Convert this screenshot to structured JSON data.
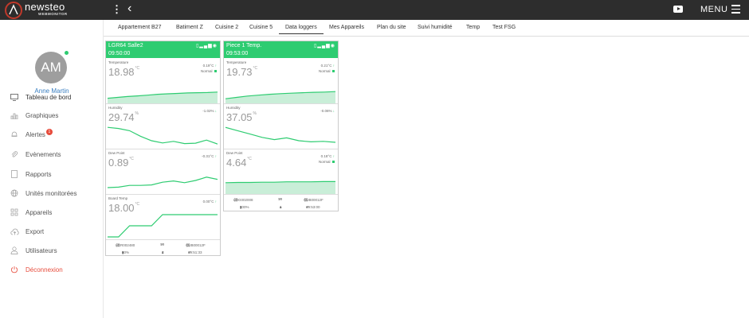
{
  "header": {
    "brand": "newsteo",
    "brand_sub": "WEBMONITOR",
    "menu_label": "MENU",
    "icons": [
      "logo-icon",
      "vertical-dots-icon",
      "back-chevron-icon",
      "video-icon",
      "hamburger-icon"
    ]
  },
  "user": {
    "initials": "AM",
    "name": "Anne Martin",
    "status_color": "#2ecc71"
  },
  "sidebar": {
    "items": [
      {
        "label": "Tableau de bord",
        "icon": "monitor-icon"
      },
      {
        "label": "Graphiques",
        "icon": "bar-chart-icon"
      },
      {
        "label": "Alertes",
        "icon": "bell-icon",
        "badge": "1"
      },
      {
        "label": "Evènements",
        "icon": "paperclip-icon"
      },
      {
        "label": "Rapports",
        "icon": "document-icon"
      },
      {
        "label": "Unités monitorées",
        "icon": "globe-icon"
      },
      {
        "label": "Appareils",
        "icon": "grid-icon"
      },
      {
        "label": "Export",
        "icon": "cloud-upload-icon"
      },
      {
        "label": "Utilisateurs",
        "icon": "user-icon"
      },
      {
        "label": "Déconnexion",
        "icon": "power-icon"
      }
    ]
  },
  "tabs": [
    "Appartement B27",
    "Batiment Z",
    "Cuisine 2",
    "Cuisine 5",
    "Data loggers",
    "Mes Appareils",
    "Plan du site",
    "Suivi humidité",
    "Temp",
    "Test FSG"
  ],
  "active_tab": "Data loggers",
  "colors": {
    "accent": "#2ecc71",
    "badge": "#e74c3c",
    "link": "#3a7fc1",
    "topbar": "#2d2d2d"
  },
  "loggers": [
    {
      "name": "LGR64 Salle2",
      "time": "09:50:00",
      "header_icons": [
        "sim-icon",
        "signal-icon",
        "wifi-icon"
      ],
      "sensors": [
        {
          "label": "Temperature",
          "value": "18.98",
          "unit": "°C",
          "delta": "0.19°C",
          "status": "Normal",
          "trend": "up",
          "area": true,
          "series": [
            12,
            16,
            20,
            23,
            26,
            30,
            32,
            34,
            36,
            37,
            38,
            40
          ]
        },
        {
          "label": "Humidity",
          "value": "29.74",
          "unit": "%",
          "delta": "-1.02%",
          "status": "",
          "trend": "down",
          "area": false,
          "series": [
            85,
            80,
            70,
            45,
            25,
            15,
            22,
            12,
            14,
            28,
            10
          ]
        },
        {
          "label": "Dew Point",
          "value": "0.89",
          "unit": "°C",
          "delta": "-0.31°C",
          "status": "",
          "trend": "up",
          "area": false,
          "series": [
            18,
            20,
            28,
            28,
            30,
            42,
            48,
            40,
            50,
            65,
            55
          ]
        },
        {
          "label": "Board Temp",
          "value": "18.00",
          "unit": "°C",
          "delta": "0.00°C",
          "status": "",
          "trend": "up",
          "area": false,
          "series": [
            0,
            0,
            50,
            50,
            50,
            100,
            100,
            100,
            100,
            100,
            100
          ]
        }
      ],
      "footer": {
        "id_left": "LGR002480",
        "range": "10",
        "range_unit": "min",
        "id_right": "CUB00012F",
        "battery": "60%",
        "signal": "7",
        "last": "09:51:33"
      }
    },
    {
      "name": "Piece 1 Temp.",
      "time": "09:53:00",
      "header_icons": [
        "sim-icon",
        "signal-icon",
        "wifi-icon"
      ],
      "sensors": [
        {
          "label": "Temperature",
          "value": "19.73",
          "unit": "°C",
          "delta": "0.21°C",
          "status": "Normal",
          "trend": "up",
          "area": true,
          "series": [
            10,
            16,
            22,
            26,
            30,
            33,
            35,
            37,
            39,
            40,
            42
          ]
        },
        {
          "label": "Humidity",
          "value": "37.05",
          "unit": "%",
          "delta": "-0.06%",
          "status": "",
          "trend": "down",
          "area": false,
          "series": [
            85,
            70,
            55,
            40,
            30,
            38,
            25,
            20,
            22,
            18
          ]
        },
        {
          "label": "Dew Point",
          "value": "4.64",
          "unit": "°C",
          "delta": "0.18°C",
          "status": "Normal",
          "trend": "up",
          "area": true,
          "series": [
            40,
            41,
            41,
            42,
            42,
            44,
            44,
            44,
            45,
            45
          ]
        }
      ],
      "footer": {
        "id_left": "LOG002008",
        "range": "10",
        "range_unit": "min",
        "id_right": "CUB00012F",
        "battery": "100%",
        "signal": "1",
        "last": "09:53:00"
      }
    }
  ]
}
